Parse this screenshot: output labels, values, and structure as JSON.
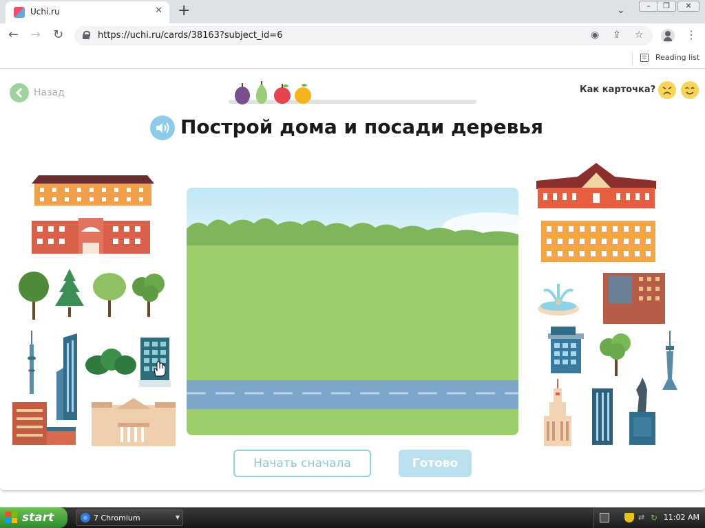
{
  "browser": {
    "tab_title": "Uchi.ru",
    "tab_close": "✕",
    "new_tab": "+",
    "url": "https://uchi.ru/cards/38163?subject_id=6",
    "reading_list": "Reading list"
  },
  "page": {
    "back_label": "Назад",
    "rate_label": "Как карточка?",
    "title": "Построй дома и посади деревья",
    "restart_label": "Начать сначала",
    "done_label": "Готово"
  },
  "colors": {
    "back_green": "#9ed39e",
    "sky": "#cdeef8",
    "grass": "#9ccf6b",
    "road": "#7ba5c9",
    "button_teal": "#8fd4dc",
    "button_done": "#bce1ee"
  },
  "taskbar": {
    "start": "start",
    "window": "7 Chromium",
    "clock": "11:02 AM"
  }
}
